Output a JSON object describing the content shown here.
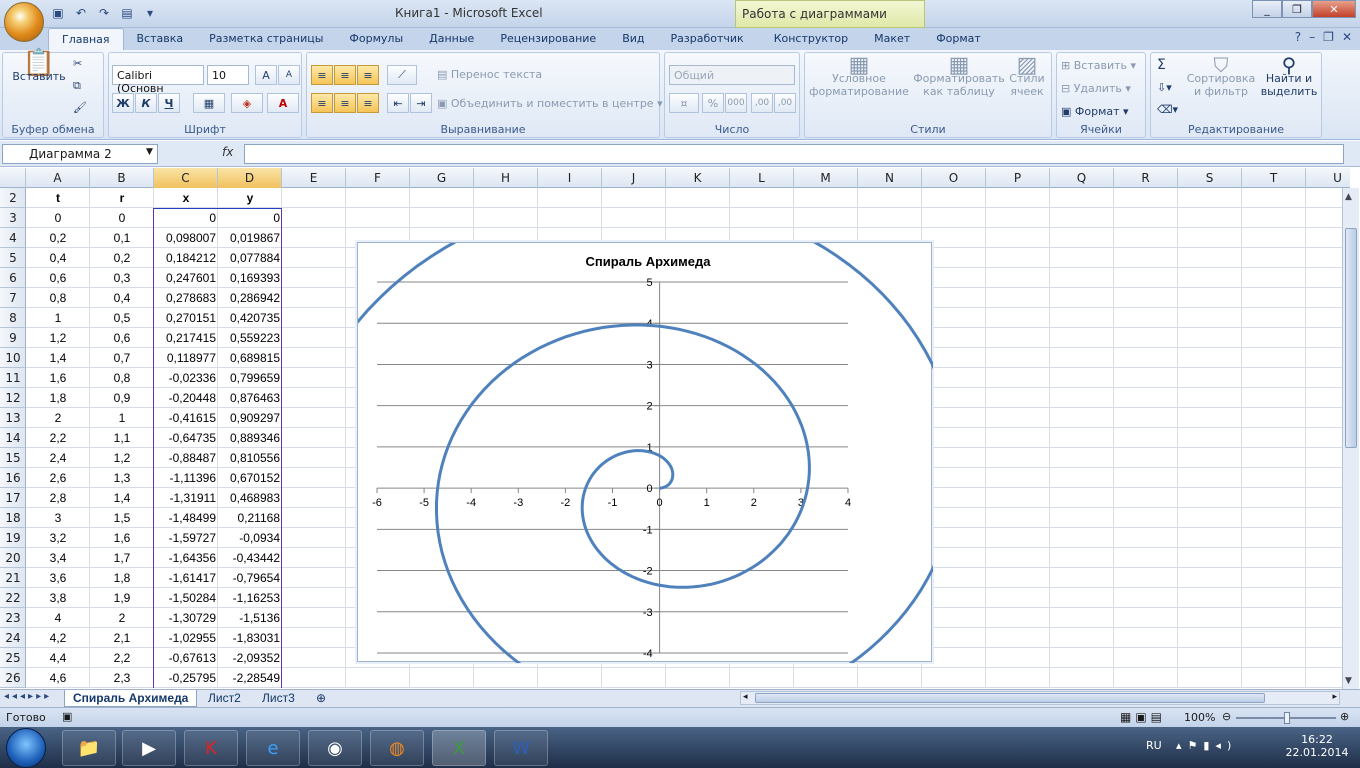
{
  "window": {
    "title": "Книга1 - Microsoft Excel",
    "context_tab": "Работа с диаграммами"
  },
  "tabs": [
    "Главная",
    "Вставка",
    "Разметка страницы",
    "Формулы",
    "Данные",
    "Рецензирование",
    "Вид",
    "Разработчик",
    "Конструктор",
    "Макет",
    "Формат"
  ],
  "ribbon": {
    "clipboard": {
      "paste": "Вставить",
      "label": "Буфер обмена"
    },
    "font": {
      "name": "Calibri (Основн",
      "size": "10",
      "label": "Шрифт",
      "bold": "Ж",
      "italic": "К",
      "underline": "Ч",
      "grow": "A",
      "shrink": "A"
    },
    "alignment": {
      "wrap": "Перенос текста",
      "merge": "Объединить и поместить в центре",
      "label": "Выравнивание"
    },
    "number": {
      "format": "Общий",
      "percent": "%",
      "thousands": "000",
      "inc": ",00",
      "dec": ",00",
      "label": "Число"
    },
    "styles": {
      "cond1": "Условное",
      "cond2": "форматирование",
      "table1": "Форматировать",
      "table2": "как таблицу",
      "cell1": "Стили",
      "cell2": "ячеек",
      "label": "Стили"
    },
    "cells": {
      "insert": "Вставить",
      "delete": "Удалить",
      "format": "Формат",
      "label": "Ячейки"
    },
    "editing": {
      "sigma": "Σ",
      "sort1": "Сортировка",
      "sort2": "и фильтр",
      "find1": "Найти и",
      "find2": "выделить",
      "label": "Редактирование"
    }
  },
  "formula_bar": {
    "name_box": "Диаграмма 2",
    "fx": "fx",
    "content": ""
  },
  "columns": [
    "A",
    "B",
    "C",
    "D",
    "E",
    "F",
    "G",
    "H",
    "I",
    "J",
    "K",
    "L",
    "M",
    "N",
    "O",
    "P",
    "Q",
    "R",
    "S",
    "T",
    "U"
  ],
  "rows": [
    "2",
    "3",
    "4",
    "5",
    "6",
    "7",
    "8",
    "9",
    "10",
    "11",
    "12",
    "13",
    "14",
    "15",
    "16",
    "17",
    "18",
    "19",
    "20",
    "21",
    "22",
    "23",
    "24",
    "25",
    "26"
  ],
  "headers": [
    "t",
    "r",
    "x",
    "y"
  ],
  "table": [
    [
      "0",
      "0",
      "0",
      "0"
    ],
    [
      "0,2",
      "0,1",
      "0,098007",
      "0,019867"
    ],
    [
      "0,4",
      "0,2",
      "0,184212",
      "0,077884"
    ],
    [
      "0,6",
      "0,3",
      "0,247601",
      "0,169393"
    ],
    [
      "0,8",
      "0,4",
      "0,278683",
      "0,286942"
    ],
    [
      "1",
      "0,5",
      "0,270151",
      "0,420735"
    ],
    [
      "1,2",
      "0,6",
      "0,217415",
      "0,559223"
    ],
    [
      "1,4",
      "0,7",
      "0,118977",
      "0,689815"
    ],
    [
      "1,6",
      "0,8",
      "-0,02336",
      "0,799659"
    ],
    [
      "1,8",
      "0,9",
      "-0,20448",
      "0,876463"
    ],
    [
      "2",
      "1",
      "-0,41615",
      "0,909297"
    ],
    [
      "2,2",
      "1,1",
      "-0,64735",
      "0,889346"
    ],
    [
      "2,4",
      "1,2",
      "-0,88487",
      "0,810556"
    ],
    [
      "2,6",
      "1,3",
      "-1,11396",
      "0,670152"
    ],
    [
      "2,8",
      "1,4",
      "-1,31911",
      "0,468983"
    ],
    [
      "3",
      "1,5",
      "-1,48499",
      "0,21168"
    ],
    [
      "3,2",
      "1,6",
      "-1,59727",
      "-0,0934"
    ],
    [
      "3,4",
      "1,7",
      "-1,64356",
      "-0,43442"
    ],
    [
      "3,6",
      "1,8",
      "-1,61417",
      "-0,79654"
    ],
    [
      "3,8",
      "1,9",
      "-1,50284",
      "-1,16253"
    ],
    [
      "4",
      "2",
      "-1,30729",
      "-1,5136"
    ],
    [
      "4,2",
      "2,1",
      "-1,02955",
      "-1,83031"
    ],
    [
      "4,4",
      "2,2",
      "-0,67613",
      "-2,09352"
    ],
    [
      "4,6",
      "2,3",
      "-0,25795",
      "-2,28549"
    ]
  ],
  "chart_data": {
    "type": "scatter",
    "title": "Спираль Архимеда",
    "xlim": [
      -6,
      4
    ],
    "ylim": [
      -4,
      5
    ],
    "x_ticks": [
      "-6",
      "-5",
      "-4",
      "-3",
      "-2",
      "-1",
      "0",
      "1",
      "2",
      "3",
      "4"
    ],
    "y_ticks": [
      "5",
      "4",
      "3",
      "2",
      "1",
      "0",
      "-1",
      "-2",
      "-3",
      "-4"
    ],
    "grid": "horizontal",
    "line_color": "#4f81bd",
    "spiral": {
      "r_per_t": 0.5,
      "t_start": 0,
      "t_end": 15.4,
      "t_step": 0.05
    }
  },
  "sheets": [
    "Спираль Архимеда",
    "Лист2",
    "Лист3"
  ],
  "status": {
    "ready": "Готово",
    "zoom": "100%"
  },
  "taskbar": {
    "lang": "RU",
    "time": "16:22",
    "date": "22.01.2014"
  }
}
